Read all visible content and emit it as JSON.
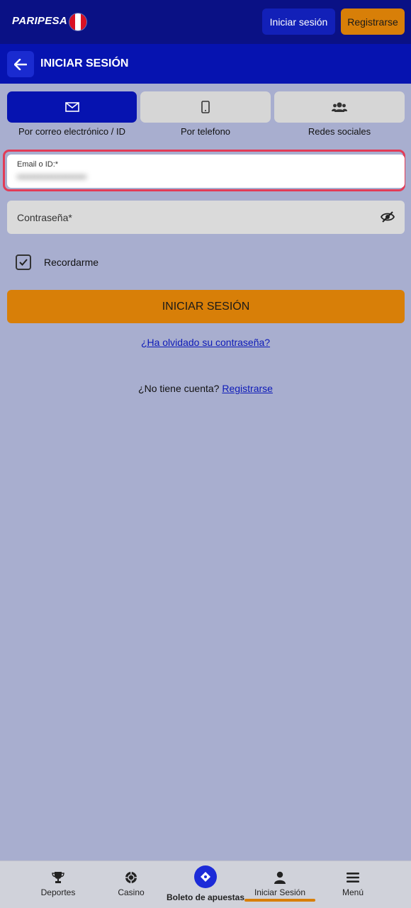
{
  "header": {
    "logo": "PARIPESA",
    "login_label": "Iniciar sesión",
    "register_label": "Registrarse"
  },
  "subheader": {
    "title": "INICIAR SESIÓN"
  },
  "tabs": [
    {
      "label": "Por correo electrónico / ID",
      "icon": "envelope-icon",
      "active": true
    },
    {
      "label": "Por telefono",
      "icon": "phone-icon",
      "active": false
    },
    {
      "label": "Redes sociales",
      "icon": "users-icon",
      "active": false
    }
  ],
  "form": {
    "email_label": "Email o ID:*",
    "email_value": "••••••••••••••••••••",
    "password_placeholder": "Contraseña*",
    "remember_label": "Recordarme",
    "remember_checked": true,
    "submit_label": "INICIAR SESIÓN",
    "forgot_label": "¿Ha olvidado su contraseña?",
    "no_account_text": "¿No tiene cuenta?",
    "register_link": "Registrarse"
  },
  "bottom_nav": [
    {
      "label": "Deportes",
      "icon": "trophy-icon"
    },
    {
      "label": "Casino",
      "icon": "casino-chip-icon"
    },
    {
      "label": "Boleto de apuestas",
      "icon": "ticket-icon"
    },
    {
      "label": "Iniciar Sesión",
      "icon": "user-icon",
      "active": true
    },
    {
      "label": "Menú",
      "icon": "menu-icon"
    }
  ],
  "colors": {
    "primary_dark": "#0a1185",
    "primary": "#0613b0",
    "accent": "#d87f08",
    "background": "#a8aecf",
    "highlight": "#e23b57"
  }
}
